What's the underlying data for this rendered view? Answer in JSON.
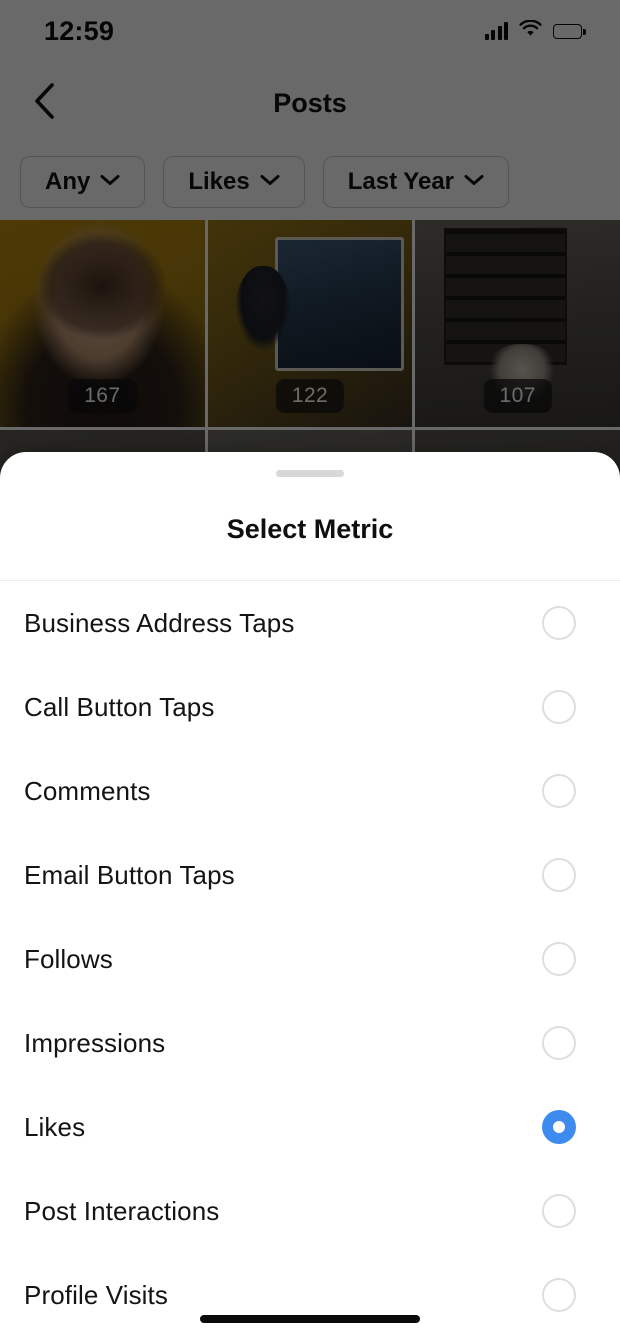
{
  "status_bar": {
    "time": "12:59",
    "signal_icon": "cellular-signal-icon",
    "wifi_icon": "wifi-icon",
    "battery_icon": "battery-icon"
  },
  "nav": {
    "back_icon": "chevron-left-icon",
    "title": "Posts"
  },
  "filters": [
    {
      "label": "Any",
      "chevron_icon": "chevron-down-icon"
    },
    {
      "label": "Likes",
      "chevron_icon": "chevron-down-icon"
    },
    {
      "label": "Last Year",
      "chevron_icon": "chevron-down-icon"
    }
  ],
  "posts": [
    {
      "count": "167"
    },
    {
      "count": "122"
    },
    {
      "count": "107"
    }
  ],
  "sheet": {
    "handle": "drag-handle",
    "title": "Select Metric",
    "selected_metric": "Likes",
    "metrics": [
      {
        "label": "Business Address Taps",
        "selected": false
      },
      {
        "label": "Call Button Taps",
        "selected": false
      },
      {
        "label": "Comments",
        "selected": false
      },
      {
        "label": "Email Button Taps",
        "selected": false
      },
      {
        "label": "Follows",
        "selected": false
      },
      {
        "label": "Impressions",
        "selected": false
      },
      {
        "label": "Likes",
        "selected": true
      },
      {
        "label": "Post Interactions",
        "selected": false
      },
      {
        "label": "Profile Visits",
        "selected": false
      }
    ]
  },
  "colors": {
    "accent_selected": "#3d8bef",
    "radio_unselected_border": "#dedede",
    "sheet_background": "#ffffff",
    "scrim": "rgba(0,0,0,0.58)",
    "text_primary": "#141414"
  },
  "home_indicator": "home-indicator"
}
